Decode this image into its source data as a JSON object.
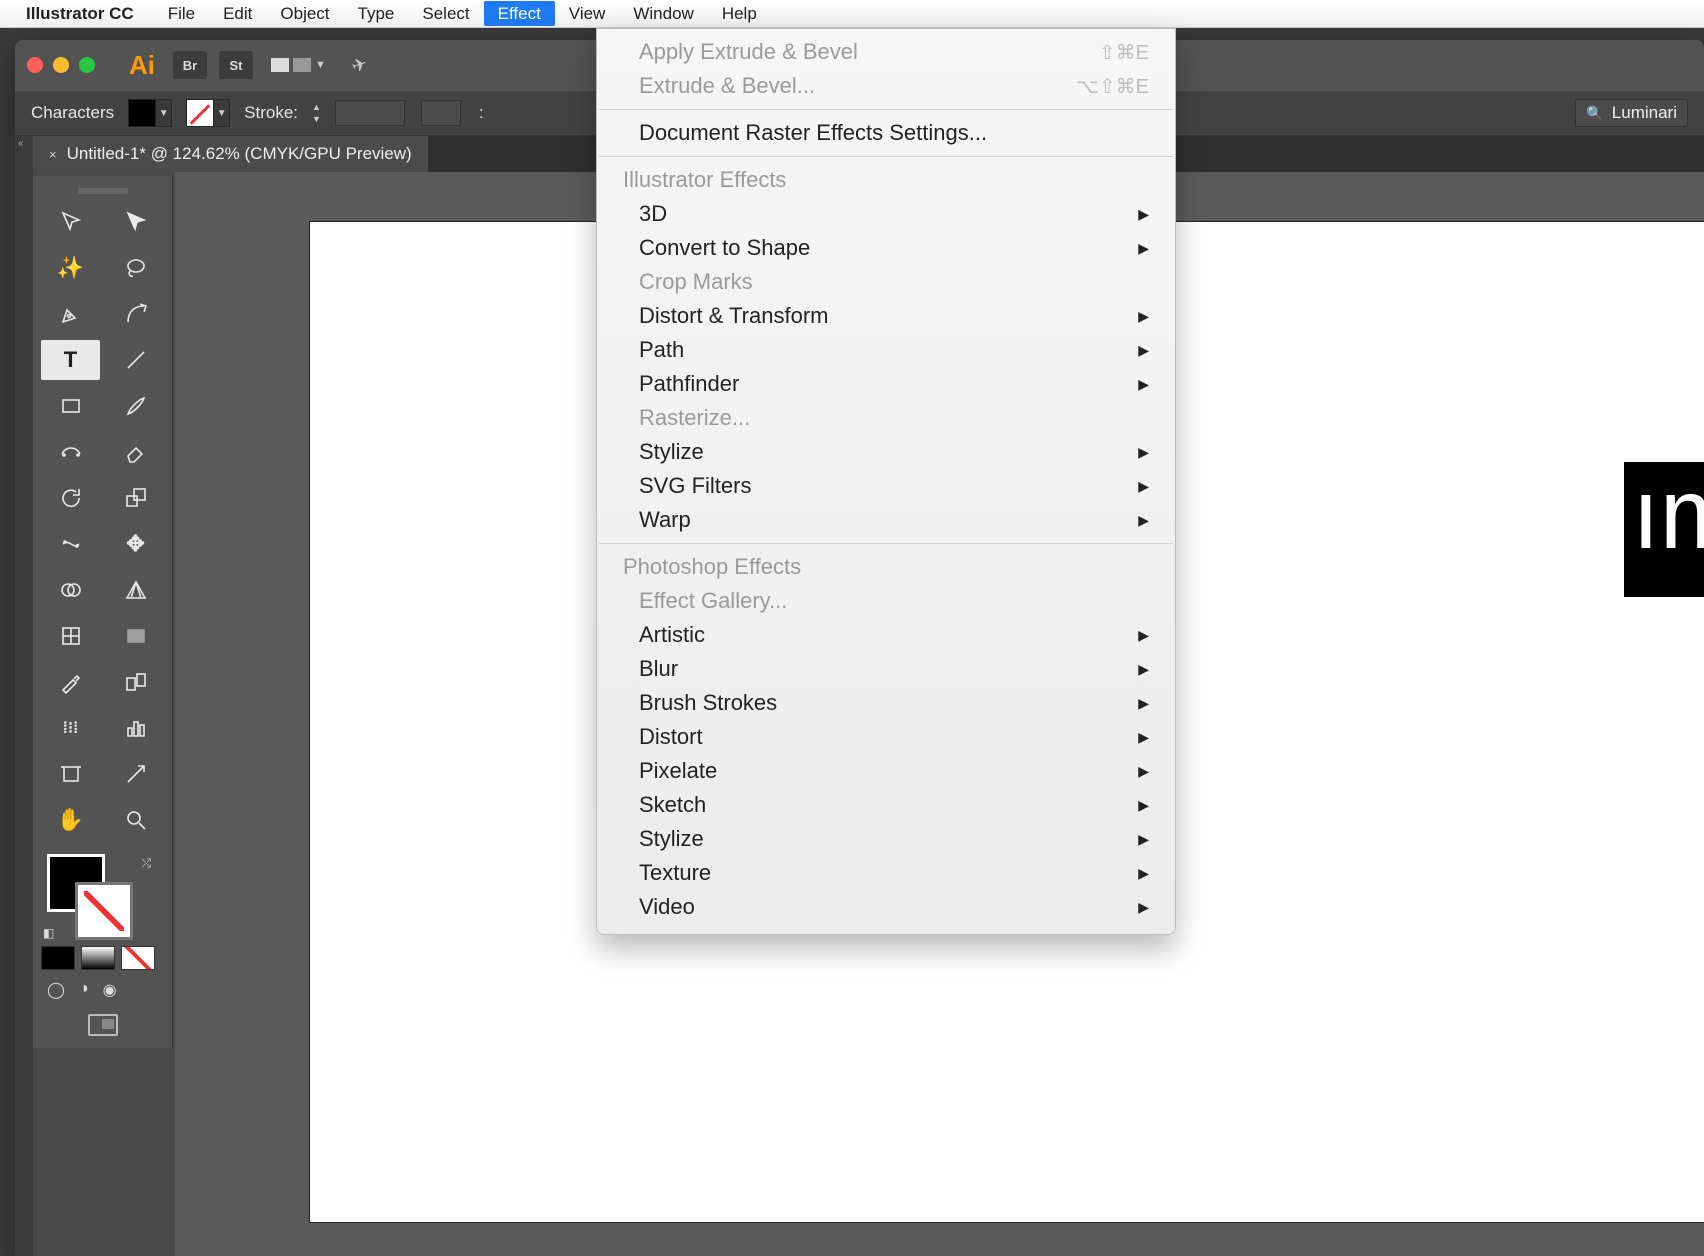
{
  "menubar": {
    "app_name": "Illustrator CC",
    "items": [
      "File",
      "Edit",
      "Object",
      "Type",
      "Select",
      "Effect",
      "View",
      "Window",
      "Help"
    ],
    "active_index": 5
  },
  "titlebar": {
    "ai_label": "Ai",
    "br_label": "Br",
    "st_label": "St"
  },
  "controlbar": {
    "left_label": "Characters",
    "stroke_label": "Stroke:",
    "search_value": "Luminari",
    "truncated_label": ":"
  },
  "tab": {
    "title": "Untitled-1* @ 124.62% (CMYK/GPU Preview)",
    "close": "×"
  },
  "canvas_text": "ım",
  "dropdown": {
    "apply_last": "Apply Extrude & Bevel",
    "apply_last_sc": "⇧⌘E",
    "last_dots": "Extrude & Bevel...",
    "last_dots_sc": "⌥⇧⌘E",
    "doc_raster": "Document Raster Effects Settings...",
    "header1": "Illustrator Effects",
    "items1": [
      {
        "label": "3D",
        "sub": true
      },
      {
        "label": "Convert to Shape",
        "sub": true
      },
      {
        "label": "Crop Marks",
        "disabled": true
      },
      {
        "label": "Distort & Transform",
        "sub": true
      },
      {
        "label": "Path",
        "sub": true
      },
      {
        "label": "Pathfinder",
        "sub": true
      },
      {
        "label": "Rasterize...",
        "disabled": true
      },
      {
        "label": "Stylize",
        "sub": true
      },
      {
        "label": "SVG Filters",
        "sub": true
      },
      {
        "label": "Warp",
        "sub": true
      }
    ],
    "header2": "Photoshop Effects",
    "effect_gallery": "Effect Gallery...",
    "items2": [
      {
        "label": "Artistic",
        "sub": true
      },
      {
        "label": "Blur",
        "sub": true
      },
      {
        "label": "Brush Strokes",
        "sub": true
      },
      {
        "label": "Distort",
        "sub": true
      },
      {
        "label": "Pixelate",
        "sub": true
      },
      {
        "label": "Sketch",
        "sub": true
      },
      {
        "label": "Stylize",
        "sub": true
      },
      {
        "label": "Texture",
        "sub": true
      },
      {
        "label": "Video",
        "sub": true
      }
    ]
  }
}
